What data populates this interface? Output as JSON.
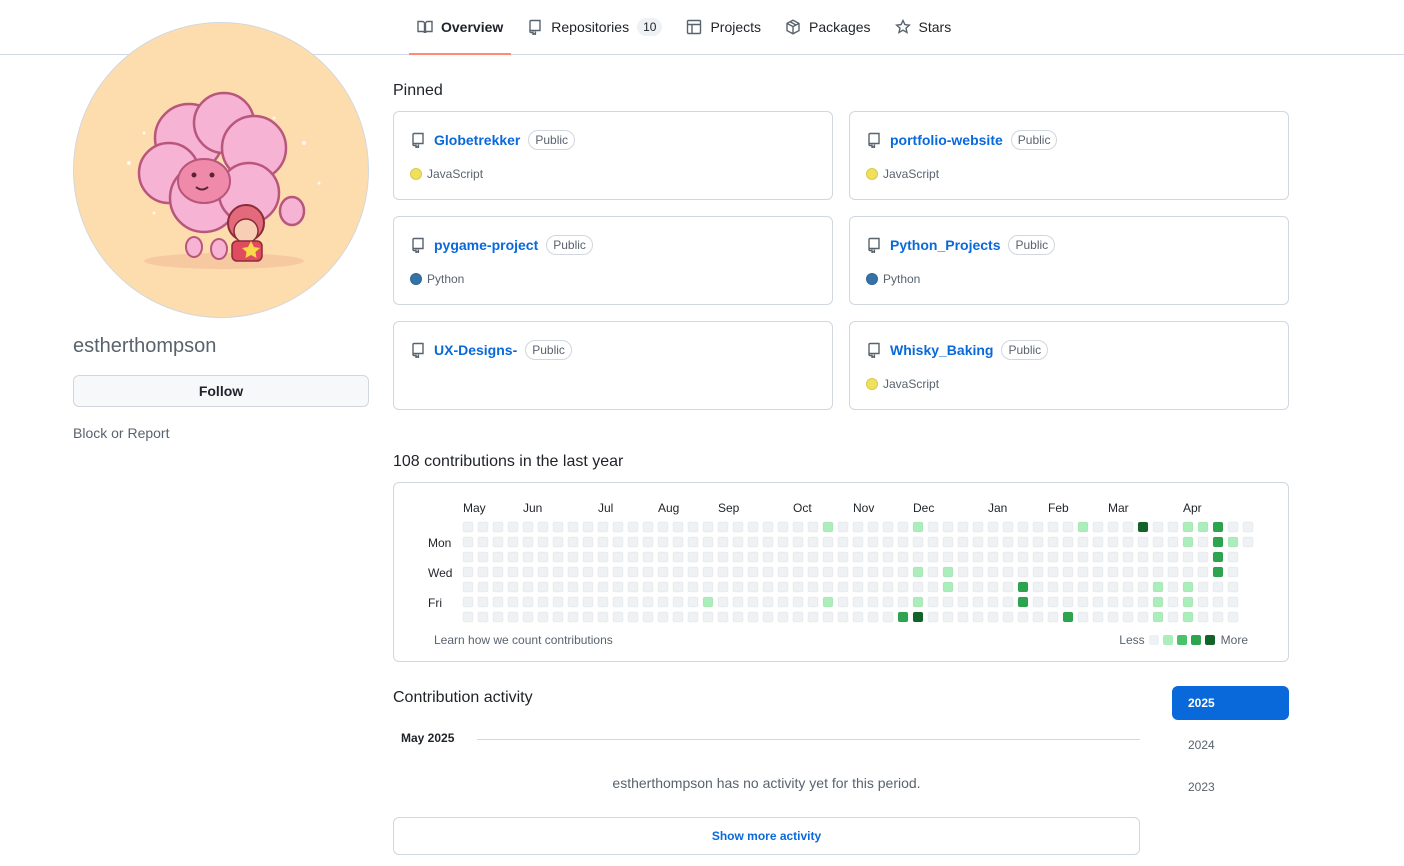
{
  "nav": {
    "tabs": [
      {
        "label": "Overview",
        "icon": "book-icon"
      },
      {
        "label": "Repositories",
        "icon": "repo-icon",
        "count": "10"
      },
      {
        "label": "Projects",
        "icon": "table-icon"
      },
      {
        "label": "Packages",
        "icon": "package-icon"
      },
      {
        "label": "Stars",
        "icon": "star-icon"
      }
    ]
  },
  "profile": {
    "username": "estherthompson",
    "follow_label": "Follow",
    "block_label": "Block or Report"
  },
  "pinned": {
    "title": "Pinned",
    "repos": [
      {
        "name": "Globetrekker",
        "visibility": "Public",
        "language": "JavaScript",
        "lang_color": "#f1e05a"
      },
      {
        "name": "portfolio-website",
        "visibility": "Public",
        "language": "JavaScript",
        "lang_color": "#f1e05a"
      },
      {
        "name": "pygame-project",
        "visibility": "Public",
        "language": "Python",
        "lang_color": "#3572A5"
      },
      {
        "name": "Python_Projects",
        "visibility": "Public",
        "language": "Python",
        "lang_color": "#3572A5"
      },
      {
        "name": "UX-Designs-",
        "visibility": "Public",
        "language": "",
        "lang_color": ""
      },
      {
        "name": "Whisky_Baking",
        "visibility": "Public",
        "language": "JavaScript",
        "lang_color": "#f1e05a"
      }
    ]
  },
  "contributions": {
    "title": "108 contributions in the last year",
    "months": [
      "May",
      "Jun",
      "Jul",
      "Aug",
      "Sep",
      "Oct",
      "Nov",
      "Dec",
      "Jan",
      "Feb",
      "Mar",
      "Apr"
    ],
    "day_labels": [
      "Mon",
      "Wed",
      "Fri"
    ],
    "learn_label": "Learn how we count contributions",
    "legend_less": "Less",
    "legend_more": "More",
    "level_colors": [
      "#eff2f5",
      "#aceebb",
      "#4ac26b",
      "#2da44e",
      "#116329"
    ],
    "active_cells": [
      [
        24,
        0,
        1
      ],
      [
        24,
        5,
        1
      ],
      [
        30,
        0,
        1
      ],
      [
        30,
        3,
        1
      ],
      [
        30,
        5,
        1
      ],
      [
        29,
        6,
        3
      ],
      [
        30,
        6,
        4
      ],
      [
        32,
        3,
        1
      ],
      [
        32,
        4,
        1
      ],
      [
        37,
        4,
        3
      ],
      [
        37,
        5,
        3
      ],
      [
        16,
        5,
        1
      ],
      [
        40,
        6,
        3
      ],
      [
        41,
        0,
        1
      ],
      [
        45,
        0,
        4
      ],
      [
        46,
        4,
        1
      ],
      [
        46,
        5,
        1
      ],
      [
        46,
        6,
        1
      ],
      [
        48,
        0,
        1
      ],
      [
        48,
        1,
        1
      ],
      [
        48,
        4,
        1
      ],
      [
        48,
        5,
        1
      ],
      [
        48,
        6,
        1
      ],
      [
        49,
        0,
        1
      ],
      [
        50,
        0,
        3
      ],
      [
        50,
        1,
        3
      ],
      [
        50,
        2,
        3
      ],
      [
        50,
        3,
        3
      ],
      [
        51,
        1,
        1
      ]
    ]
  },
  "activity": {
    "title": "Contribution activity",
    "month": "May 2025",
    "empty_message": "estherthompson has no activity yet for this period.",
    "show_more_label": "Show more activity",
    "years": [
      "2025",
      "2024",
      "2023"
    ],
    "selected_year": "2025"
  }
}
